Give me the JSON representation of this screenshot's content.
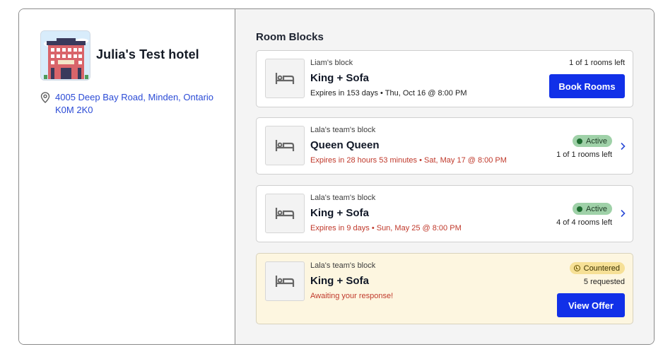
{
  "hotel": {
    "name": "Julia's Test hotel",
    "address": "4005 Deep Bay Road, Minden, Ontario K0M 2K0",
    "image_icon": "hotel-building-icon"
  },
  "room_blocks": {
    "title": "Room Blocks",
    "items": [
      {
        "owner": "Liam's block",
        "room_type": "King + Sofa",
        "expiry": "Expires in 153 days • Thu, Oct 16 @ 8:00 PM",
        "rooms_left": "1 of 1 rooms left",
        "button": "Book Rooms"
      },
      {
        "owner": "Lala's team's block",
        "room_type": "Queen Queen",
        "expiry": "Expires in 28 hours 53 minutes • Sat, May 17 @ 8:00 PM",
        "status": "Active",
        "rooms_left": "1 of 1 rooms left"
      },
      {
        "owner": "Lala's team's block",
        "room_type": "King + Sofa",
        "expiry": "Expires in 9 days • Sun, May 25 @ 8:00 PM",
        "status": "Active",
        "rooms_left": "4 of 4 rooms left"
      },
      {
        "owner": "Lala's team's block",
        "room_type": "King + Sofa",
        "expiry": "Awaiting your response!",
        "status": "Countered",
        "requested": "5 requested",
        "button": "View Offer"
      }
    ]
  },
  "colors": {
    "primary_button": "#1130e8",
    "link": "#2b4bd6",
    "warning_text": "#c0392b",
    "active_badge": "#9fd1a8",
    "countered_badge": "#f6e096",
    "countered_card": "#fdf6e0"
  }
}
